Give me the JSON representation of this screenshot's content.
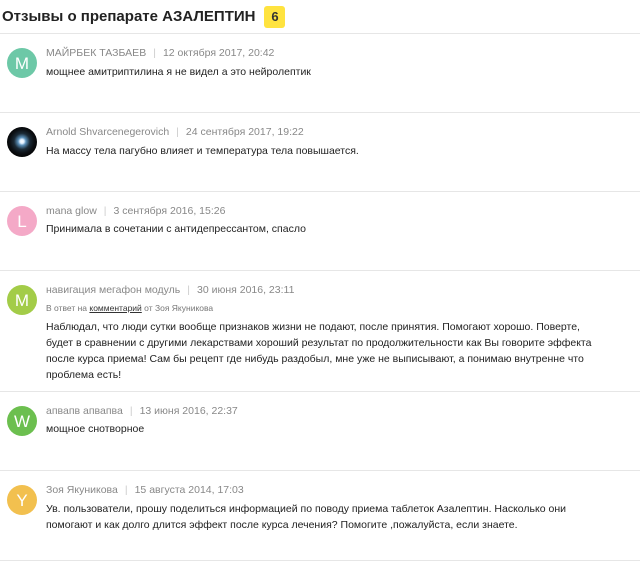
{
  "header": {
    "title": "Отзывы о препарате АЗАЛЕПТИН",
    "count": "6",
    "badge_color": "#ffe33f"
  },
  "reviews": [
    {
      "avatar_letter": "M",
      "avatar_color": "#6dc8a7",
      "author": "МАЙРБЕК ТАЗБАЕВ",
      "date": "12 октября 2017, 20:42",
      "text": "мощнее амитриптилина я не видел а это нейролептик"
    },
    {
      "avatar_letter": "",
      "avatar_icon": "galaxy-photo-avatar",
      "author": "Arnold Shvarcenegerovich",
      "date": "24 сентября 2017, 19:22",
      "text": "На массу тела пагубно влияет и температура тела повышается."
    },
    {
      "avatar_letter": "L",
      "avatar_color": "#f4a9c7",
      "author": "mana glow",
      "date": "3 сентября 2016, 15:26",
      "text": "Принимала в сочетании с антидепрессантом, спасло"
    },
    {
      "avatar_letter": "M",
      "avatar_color": "#a3cc48",
      "author": "навигация мегафон модуль",
      "date": "30 июня 2016, 23:11",
      "reply_prefix": "В ответ на",
      "reply_link": "комментарий",
      "reply_to": "от Зоя Якуникова",
      "text": "Наблюдал, что люди сутки вообще признаков жизни не подают, после принятия. Помогают хорошо. Поверте, будет в сравнении с другими лекарствами хороший результат по продолжительности как Вы говорите эффекта после курса приема! Сам бы рецепт где нибудь раздобыл, мне уже не выписывают, а понимаю внутренне что проблема есть!"
    },
    {
      "avatar_letter": "W",
      "avatar_color": "#6cbf4f",
      "author": "апвапв апвапва",
      "date": "13 июня 2016, 22:37",
      "text": "мощное снотворное"
    },
    {
      "avatar_letter": "Y",
      "avatar_color": "#f2c04f",
      "author": "Зоя Якуникова",
      "date": "15 августа 2014, 17:03",
      "text": "Ув. пользователи, прошу поделиться информацией по поводу приема таблеток Азалептин. Насколько они помогают и как долго длится эффект после курса лечения? Помогите ,пожалуйста, если знаете."
    }
  ]
}
